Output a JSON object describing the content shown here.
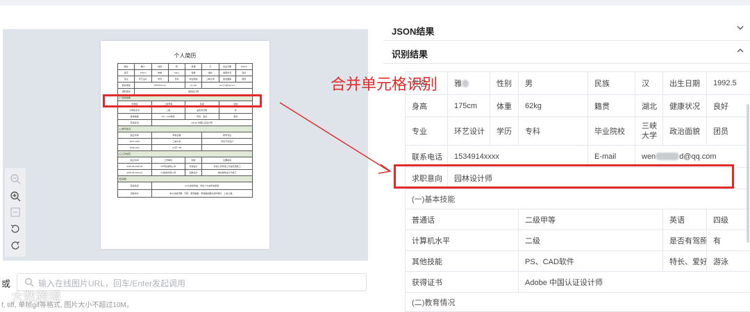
{
  "preview": {
    "paper_title": "个人简历",
    "mini_rows": [
      [
        "姓名",
        "雅◯",
        "性别",
        "男",
        "民族",
        "汉",
        "出生日期",
        "1992.5"
      ],
      [
        "身高",
        "175cm",
        "体重",
        "62kg",
        "籍贯",
        "湖北",
        "健康状况",
        "良好"
      ],
      [
        "专业",
        "环艺设计",
        "学历",
        "专科",
        "毕业院校",
        "三峡大学",
        "政治面貌",
        "团员"
      ],
      [
        "联系电话",
        "1534914xxxx",
        "",
        "",
        "E-mail",
        "",
        "wen◯d@qq.com",
        ""
      ]
    ],
    "mini_intent_label": "求职意向",
    "mini_intent_value": "园林设计师",
    "mini_basic_rows": [
      [
        "普通话",
        "二级甲等",
        "英语",
        "四级"
      ],
      [
        "计算机水平",
        "二级",
        "是否有驾照",
        "有"
      ],
      [
        "其他技能",
        "PS、CAD软件",
        "特长、爱好",
        "游泳"
      ],
      [
        "获得证书",
        "Adobe 中国认证设计师",
        "",
        ""
      ]
    ],
    "mini_sec_edu": "(二)教育情况",
    "mini_edu_head": [
      "起止时间",
      "学校全程",
      "所学专业"
    ],
    "mini_edu_rows": [
      [
        "2012-2016",
        "三峡大学",
        "环境艺术设计"
      ],
      [
        "2009-2012",
        "XX高一中",
        ""
      ]
    ],
    "mini_sec_work": "(三)工作经历",
    "mini_work_head": [
      "起止时间",
      "工作单位",
      "职务",
      "主要职责"
    ],
    "mini_work_rows": [
      [
        "2016.08-2018.08",
        "XX环境装饰公司",
        "景观设计",
        "负责公司景观上方案景观施工"
      ],
      [
        "2018.09-2019.10",
        "XX园林景观公司",
        "园林设计",
        "绿化建筑设计与施工"
      ]
    ],
    "mini_sec_other": "(四)其他",
    "mini_other_rows": [
      [
        "获奖情况",
        "XX大学奖学金、学生十大青年志愿者"
      ],
      [
        "自我评价",
        "本人性格开朗、沉稳、踏实做事、有较强的团队合作意识、上进心强。"
      ]
    ]
  },
  "tools": [
    "zoom-out",
    "zoom-in",
    "fit",
    "rotate-left",
    "rotate-right"
  ],
  "input": {
    "or_label": "或",
    "placeholder": "输入在线图片URL，回车/Enter发起调用"
  },
  "foot_note": "f, tiff, 单帧gif等格式, 图片大小不超过10M。",
  "watermark": "大数跨境",
  "panel": {
    "json_title": "JSON结果",
    "result_title": "识别结果"
  },
  "annotation": "合并单元格识别",
  "result": {
    "row1": {
      "c1": "姓名",
      "c2": "雅",
      "c3": "性别",
      "c4": "男",
      "c5": "民族",
      "c6": "汉",
      "c7": "出生日期",
      "c8": "1992.5"
    },
    "row2": {
      "c1": "身高",
      "c2": "175cm",
      "c3": "体重",
      "c4": "62kg",
      "c5": "籍贯",
      "c6": "湖北",
      "c7": "健康状况",
      "c8": "良好"
    },
    "row3": {
      "c1": "专业",
      "c2": "环艺设计",
      "c3": "学历",
      "c4": "专科",
      "c5": "毕业院校",
      "c6": "三峡大学",
      "c7": "政治面貌",
      "c8": "团员"
    },
    "row4": {
      "c1": "联系电话",
      "c2": "1534914xxxx",
      "c5": "E-mail",
      "c6a": "wen",
      "c6b": "d@qq.com"
    },
    "row5": {
      "c1": "求职意向",
      "c2": "园林设计师"
    },
    "sec1": "(一)基本技能",
    "row6": {
      "c1": "普通话",
      "c2": "二级甲等",
      "c3": "英语",
      "c4": "四级"
    },
    "row7": {
      "c1": "计算机水平",
      "c2": "二级",
      "c3": "是否有驾照",
      "c4": "有"
    },
    "row8": {
      "c1": "其他技能",
      "c2": "PS、CAD软件",
      "c3": "特长、爱好",
      "c4": "游泳"
    },
    "row9": {
      "c1": "获得证书",
      "c2": "Adobe 中国认证设计师"
    },
    "sec2": "(二)教育情况"
  },
  "colors": {
    "annotation": "#e02b2b",
    "preview_bg": "#dfe3ea",
    "border": "#e4e7ed"
  }
}
